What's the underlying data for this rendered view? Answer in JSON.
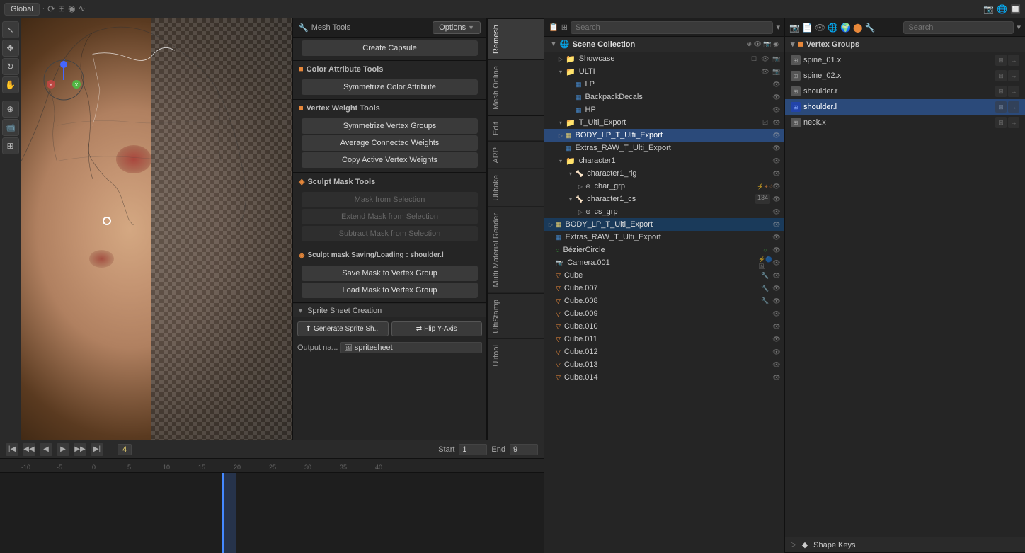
{
  "header": {
    "transform_mode": "Global",
    "options_label": "Options",
    "search_placeholder": "Search"
  },
  "tools_panel": {
    "title": "Mesh Tools",
    "create_capsule": "Create Capsule",
    "color_attribute_tools": "Color Attribute Tools",
    "symmetrize_color": "Symmetrize Color Attribute",
    "vertex_weight_tools": "Vertex Weight Tools",
    "symmetrize_vertex": "Symmetrize Vertex Groups",
    "average_connected": "Average Connected Weights",
    "copy_active": "Copy Active Vertex Weights",
    "sculpt_mask_tools": "Sculpt Mask Tools",
    "mask_from_selection": "Mask from Selection",
    "extend_mask": "Extend Mask from Selection",
    "subtract_mask": "Subtract Mask from Selection",
    "sculpt_mask_saving": "Sculpt mask Saving/Loading : shoulder.l",
    "save_mask": "Save Mask to Vertex Group",
    "load_mask": "Load Mask to Vertex Group",
    "sprite_sheet_creation": "Sprite Sheet Creation",
    "generate_sprite": "Generate Sprite Sh...",
    "flip_y_axis": "Flip Y-Axis",
    "output_name_label": "Output na...",
    "output_value": "spritesheet"
  },
  "side_tabs": {
    "tabs": [
      "Remesh",
      "Mesh Online",
      "Edit",
      "ARP",
      "Ulibake",
      "Multi Material Render",
      "UltiStamp",
      "Ulitool"
    ]
  },
  "scene_collection": {
    "title": "Scene Collection",
    "items": [
      {
        "label": "Showcase",
        "depth": 1,
        "type": "collection",
        "expanded": false
      },
      {
        "label": "ULTI",
        "depth": 1,
        "type": "collection",
        "expanded": true
      },
      {
        "label": "LP",
        "depth": 2,
        "type": "mesh"
      },
      {
        "label": "BackpackDecals",
        "depth": 2,
        "type": "mesh"
      },
      {
        "label": "HP",
        "depth": 2,
        "type": "mesh"
      },
      {
        "label": "T_Ulti_Export",
        "depth": 1,
        "type": "collection",
        "expanded": true
      },
      {
        "label": "BODY_LP_T_Ulti_Export",
        "depth": 2,
        "type": "mesh",
        "active": true
      },
      {
        "label": "Extras_RAW_T_Ulti_Export",
        "depth": 2,
        "type": "mesh"
      },
      {
        "label": "character1",
        "depth": 1,
        "type": "collection",
        "expanded": true
      },
      {
        "label": "character1_rig",
        "depth": 2,
        "type": "armature",
        "expanded": true
      },
      {
        "label": "char_grp",
        "depth": 3,
        "type": "empty"
      },
      {
        "label": "character1_cs",
        "depth": 2,
        "type": "armature",
        "expanded": true
      },
      {
        "label": "cs_grp",
        "depth": 3,
        "type": "empty"
      },
      {
        "label": "BODY_LP_T_Ulti_Export",
        "depth": 1,
        "type": "mesh",
        "active2": true
      },
      {
        "label": "Extras_RAW_T_Ulti_Export",
        "depth": 1,
        "type": "mesh"
      },
      {
        "label": "BézierCircle",
        "depth": 0,
        "type": "curve"
      },
      {
        "label": "Camera.001",
        "depth": 0,
        "type": "camera"
      },
      {
        "label": "Cube",
        "depth": 0,
        "type": "cube"
      },
      {
        "label": "Cube.007",
        "depth": 0,
        "type": "cube"
      },
      {
        "label": "Cube.008",
        "depth": 0,
        "type": "cube"
      },
      {
        "label": "Cube.009",
        "depth": 0,
        "type": "cube"
      },
      {
        "label": "Cube.010",
        "depth": 0,
        "type": "cube"
      },
      {
        "label": "Cube.011",
        "depth": 0,
        "type": "cube"
      },
      {
        "label": "Cube.012",
        "depth": 0,
        "type": "cube"
      },
      {
        "label": "Cube.013",
        "depth": 0,
        "type": "cube"
      },
      {
        "label": "Cube.014",
        "depth": 0,
        "type": "cube"
      }
    ]
  },
  "vertex_groups": {
    "title": "Vertex Groups",
    "items": [
      {
        "label": "spine_01.x",
        "active": false
      },
      {
        "label": "spine_02.x",
        "active": false
      },
      {
        "label": "shoulder.r",
        "active": false
      },
      {
        "label": "shoulder.l",
        "active": true
      },
      {
        "label": "neck.x",
        "active": false
      }
    ]
  },
  "shape_keys": {
    "title": "Shape Keys",
    "collapsed": true
  },
  "timeline": {
    "frame_current": "4",
    "frame_start_label": "Start",
    "frame_start": "1",
    "frame_end_label": "End",
    "frame_end": "9",
    "ruler_marks": [
      "-10",
      "-5",
      "0",
      "5",
      "10",
      "15",
      "20",
      "25",
      "30",
      "35",
      "40"
    ]
  }
}
